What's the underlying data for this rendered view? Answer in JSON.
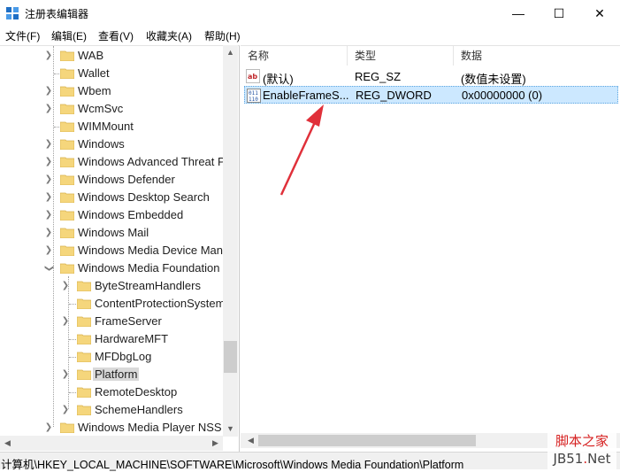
{
  "window": {
    "title": "注册表编辑器",
    "minimize_glyph": "—",
    "maximize_glyph": "☐",
    "close_glyph": "✕"
  },
  "menu": [
    {
      "label": "文件(F)"
    },
    {
      "label": "编辑(E)"
    },
    {
      "label": "查看(V)"
    },
    {
      "label": "收藏夹(A)"
    },
    {
      "label": "帮助(H)"
    }
  ],
  "tree": {
    "items": [
      {
        "label": "WAB"
      },
      {
        "label": "Wallet"
      },
      {
        "label": "Wbem"
      },
      {
        "label": "WcmSvc"
      },
      {
        "label": "WIMMount"
      },
      {
        "label": "Windows"
      },
      {
        "label": "Windows Advanced Threat P"
      },
      {
        "label": "Windows Defender"
      },
      {
        "label": "Windows Desktop Search"
      },
      {
        "label": "Windows Embedded"
      },
      {
        "label": "Windows Mail"
      },
      {
        "label": "Windows Media Device Man"
      },
      {
        "label": "Windows Media Foundation"
      },
      {
        "label": "ByteStreamHandlers"
      },
      {
        "label": "ContentProtectionSystem"
      },
      {
        "label": "FrameServer"
      },
      {
        "label": "HardwareMFT"
      },
      {
        "label": "MFDbgLog"
      },
      {
        "label": "Platform"
      },
      {
        "label": "RemoteDesktop"
      },
      {
        "label": "SchemeHandlers"
      },
      {
        "label": "Windows Media Player NSS"
      }
    ]
  },
  "list": {
    "columns": [
      {
        "label": "名称"
      },
      {
        "label": "类型"
      },
      {
        "label": "数据"
      }
    ],
    "rows": [
      {
        "name": "(默认)",
        "type": "REG_SZ",
        "data": "(数值未设置)",
        "icon": "string-value-icon"
      },
      {
        "name": "EnableFrameS...",
        "type": "REG_DWORD",
        "data": "0x00000000 (0)",
        "icon": "dword-value-icon"
      }
    ]
  },
  "status": {
    "path": "计算机\\HKEY_LOCAL_MACHINE\\SOFTWARE\\Microsoft\\Windows Media Foundation\\Platform"
  },
  "watermark": {
    "top": "脚本之家",
    "bottom_left": "JB51",
    "bottom_dot": ".",
    "bottom_right": "Net"
  },
  "colors": {
    "folder": "#f5d67c",
    "selection": "#cce8ff",
    "arrow": "#e0303a",
    "watermark": "#d62020"
  }
}
